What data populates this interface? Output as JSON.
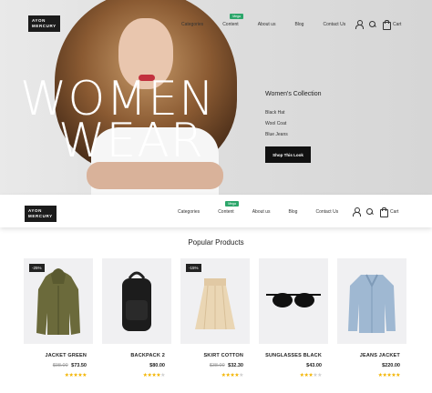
{
  "brand": {
    "line1": "AYON",
    "line2": "MERCURY"
  },
  "nav": {
    "items": [
      "Categories",
      "Content",
      "About us",
      "Blog",
      "Contact Us"
    ],
    "mega_badge": "Mega",
    "cart_label": "Cart"
  },
  "hero": {
    "title_line1": "WOMEN",
    "title_line2": "WEAR",
    "collection_title": "Women's Collection",
    "collection_items": [
      "Black Hat",
      "Wool Coat",
      "Blue Jeans"
    ],
    "cta": "Shop This Look"
  },
  "products_section": {
    "title": "Popular Products",
    "items": [
      {
        "name": "JACKET GREEN",
        "old_price": "$98.00",
        "price": "$73.50",
        "badge": "-25%",
        "rating": 5
      },
      {
        "name": "BACKPACK 2",
        "old_price": "",
        "price": "$80.00",
        "badge": "",
        "rating": 4
      },
      {
        "name": "SKIRT COTTON",
        "old_price": "$38.00",
        "price": "$32.30",
        "badge": "-15%",
        "rating": 4
      },
      {
        "name": "SUNGLASSES BLACK",
        "old_price": "",
        "price": "$43.00",
        "badge": "",
        "rating": 3
      },
      {
        "name": "JEANS JACKET",
        "old_price": "",
        "price": "$220.00",
        "badge": "",
        "rating": 5
      }
    ]
  },
  "colors": {
    "accent_green": "#2ca66a",
    "star": "#f3b400",
    "dark": "#111111"
  },
  "icons": [
    "user-icon",
    "search-icon",
    "cart-icon"
  ]
}
